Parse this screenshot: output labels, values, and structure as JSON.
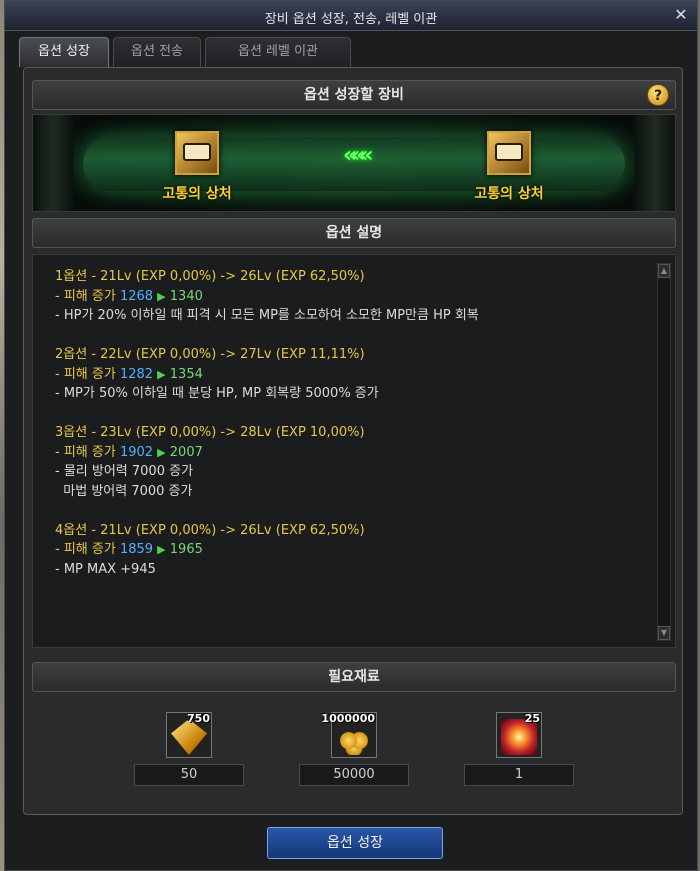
{
  "window": {
    "title": "장비 옵션 성장, 전송, 레벨 이관",
    "close_glyph": "✕"
  },
  "tabs": [
    {
      "label": "옵션 성장",
      "active": true
    },
    {
      "label": "옵션 전송",
      "active": false
    },
    {
      "label": "옵션 레벨 이관",
      "active": false
    }
  ],
  "equip_section": {
    "title": "옵션 성장할 장비",
    "help_glyph": "?",
    "source_item": "고통의 상처",
    "target_item": "고통의 상처",
    "arrow_glyph": "«««"
  },
  "description_section": {
    "title": "옵션 설명",
    "options": [
      {
        "header": "1옵션 - 21Lv (EXP 0,00%) -> 26Lv (EXP 62,50%)",
        "dmg_prefix": "- 피해 증가 ",
        "dmg_from": "1268",
        "dmg_to": "1340",
        "effects": [
          "- HP가 20% 이하일 때 피격 시 모든 MP를 소모하여 소모한 MP만큼 HP 회복"
        ]
      },
      {
        "header": "2옵션 - 22Lv (EXP 0,00%) -> 27Lv (EXP 11,11%)",
        "dmg_prefix": "- 피해 증가 ",
        "dmg_from": "1282",
        "dmg_to": "1354",
        "effects": [
          "- MP가 50% 이하일 때 분당 HP, MP 회복량 5000% 증가"
        ]
      },
      {
        "header": "3옵션 - 23Lv (EXP 0,00%) -> 28Lv (EXP 10,00%)",
        "dmg_prefix": "- 피해 증가 ",
        "dmg_from": "1902",
        "dmg_to": "2007",
        "effects": [
          "- 물리 방어력 7000 증가",
          "  마법 방어력 7000 증가"
        ]
      },
      {
        "header": "4옵션 - 21Lv (EXP 0,00%) -> 26Lv (EXP 62,50%)",
        "dmg_prefix": "- 피해 증가 ",
        "dmg_from": "1859",
        "dmg_to": "1965",
        "effects": [
          "- MP MAX +945"
        ]
      }
    ]
  },
  "materials_section": {
    "title": "필요재료",
    "materials": [
      {
        "icon": "gold-gem-icon",
        "stack": "750",
        "value": "50"
      },
      {
        "icon": "gold-coins-icon",
        "stack": "1000000",
        "value": "50000"
      },
      {
        "icon": "fire-burst-icon",
        "stack": "25",
        "value": "1"
      }
    ]
  },
  "action": {
    "label": "옵션 성장"
  },
  "colors": {
    "accent_blue": "#4fb2ff",
    "item_gold": "#ffce3a",
    "level_yellow": "#e7c64a",
    "exp_green": "#7bd67b"
  }
}
